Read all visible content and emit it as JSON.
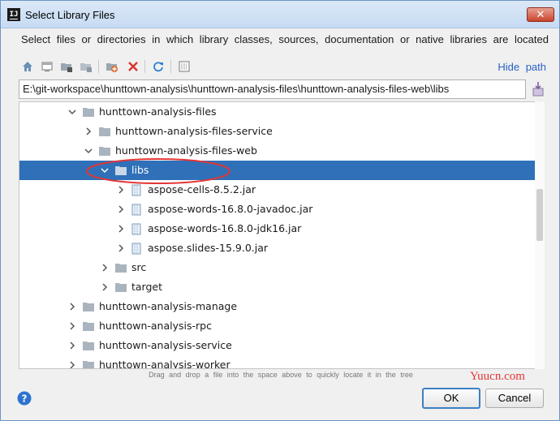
{
  "window": {
    "title": "Select Library Files",
    "app_icon_text": "IJ",
    "close_glyph": "✕"
  },
  "description": "Select files or directories in which library classes, sources, documentation or native libraries are located",
  "toolbar": {
    "buttons": [
      "home-icon",
      "desktop-icon",
      "project-icon",
      "module-icon",
      "new-folder-icon",
      "delete-icon",
      "refresh-icon",
      "show-hidden-icon"
    ],
    "hide_path_label": "Hide path"
  },
  "path_field": {
    "value": "E:\\git-workspace\\hunttown-analysis\\hunttown-analysis-files\\hunttown-analysis-files-web\\libs"
  },
  "tree": {
    "rows": [
      {
        "label": "hunttown-analysis-files",
        "type": "folder",
        "expanded": true
      },
      {
        "label": "hunttown-analysis-files-service",
        "type": "folder",
        "expanded": false
      },
      {
        "label": "hunttown-analysis-files-web",
        "type": "folder",
        "expanded": true
      },
      {
        "label": "libs",
        "type": "folder",
        "expanded": true,
        "selected": true
      },
      {
        "label": "aspose-cells-8.5.2.jar",
        "type": "jar",
        "expanded": false
      },
      {
        "label": "aspose-words-16.8.0-javadoc.jar",
        "type": "jar",
        "expanded": false
      },
      {
        "label": "aspose-words-16.8.0-jdk16.jar",
        "type": "jar",
        "expanded": false
      },
      {
        "label": "aspose.slides-15.9.0.jar",
        "type": "jar",
        "expanded": false
      },
      {
        "label": "src",
        "type": "folder",
        "expanded": false
      },
      {
        "label": "target",
        "type": "folder",
        "expanded": false
      },
      {
        "label": "hunttown-analysis-manage",
        "type": "folder",
        "expanded": false
      },
      {
        "label": "hunttown-analysis-rpc",
        "type": "folder",
        "expanded": false
      },
      {
        "label": "hunttown-analysis-service",
        "type": "folder",
        "expanded": false
      },
      {
        "label": "hunttown-analysis-worker",
        "type": "folder",
        "expanded": false
      }
    ]
  },
  "hint": "Drag and drop a file into the space above to quickly locate it in the tree",
  "watermark": "Yuucn.com",
  "buttons": {
    "ok": "OK",
    "cancel": "Cancel",
    "help_glyph": "?"
  },
  "colors": {
    "selection": "#2f70b8",
    "folder": "#aab4be",
    "annotation": "#e23636",
    "link": "#2962c4"
  }
}
